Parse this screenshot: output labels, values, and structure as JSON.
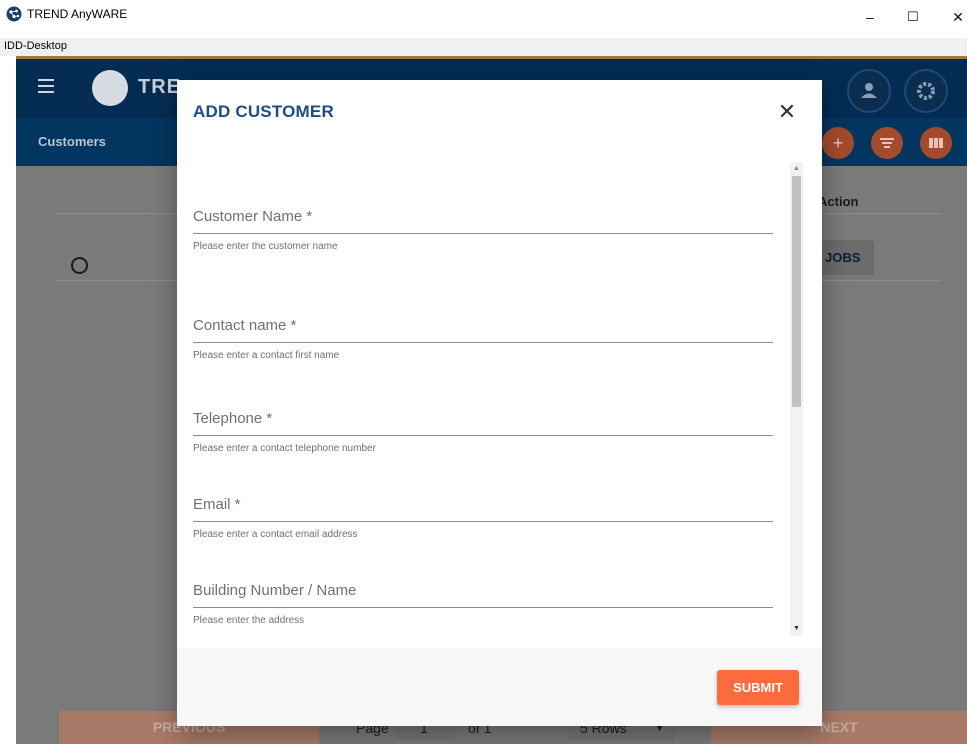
{
  "window": {
    "title": "TREND AnyWARE",
    "subtitle": "IDD-Desktop",
    "controls": {
      "minimize": "–",
      "maximize": "☐",
      "close": "✕"
    }
  },
  "header": {
    "logo_text": "TRE",
    "page_title": "Customers",
    "icons": [
      "menu-icon",
      "user-icon",
      "settings-icon",
      "add-icon",
      "filter-icon",
      "columns-icon"
    ]
  },
  "background_table": {
    "action_header": "Action",
    "jobs_button": "JOBS"
  },
  "pager": {
    "previous_label": "PREVIOUS",
    "page_label": "Page",
    "page_value": "1",
    "of_label": "of 1",
    "rows_label": "5 Rows",
    "next_label": "NEXT"
  },
  "modal": {
    "title": "ADD CUSTOMER",
    "close_glyph": "✕",
    "fields": [
      {
        "label": "Customer Name *",
        "hint": "Please enter the customer name"
      },
      {
        "label": "Contact name *",
        "hint": "Please enter a contact first name"
      },
      {
        "label": "Telephone *",
        "hint": "Please enter a contact telephone number"
      },
      {
        "label": "Email *",
        "hint": "Please enter a contact email address"
      },
      {
        "label": "Building Number / Name",
        "hint": "Please enter the address"
      }
    ],
    "submit_label": "SUBMIT"
  },
  "colors": {
    "header_bg": "#042c52",
    "accent": "#fb6b3d",
    "title_blue": "#1c4c8a"
  }
}
